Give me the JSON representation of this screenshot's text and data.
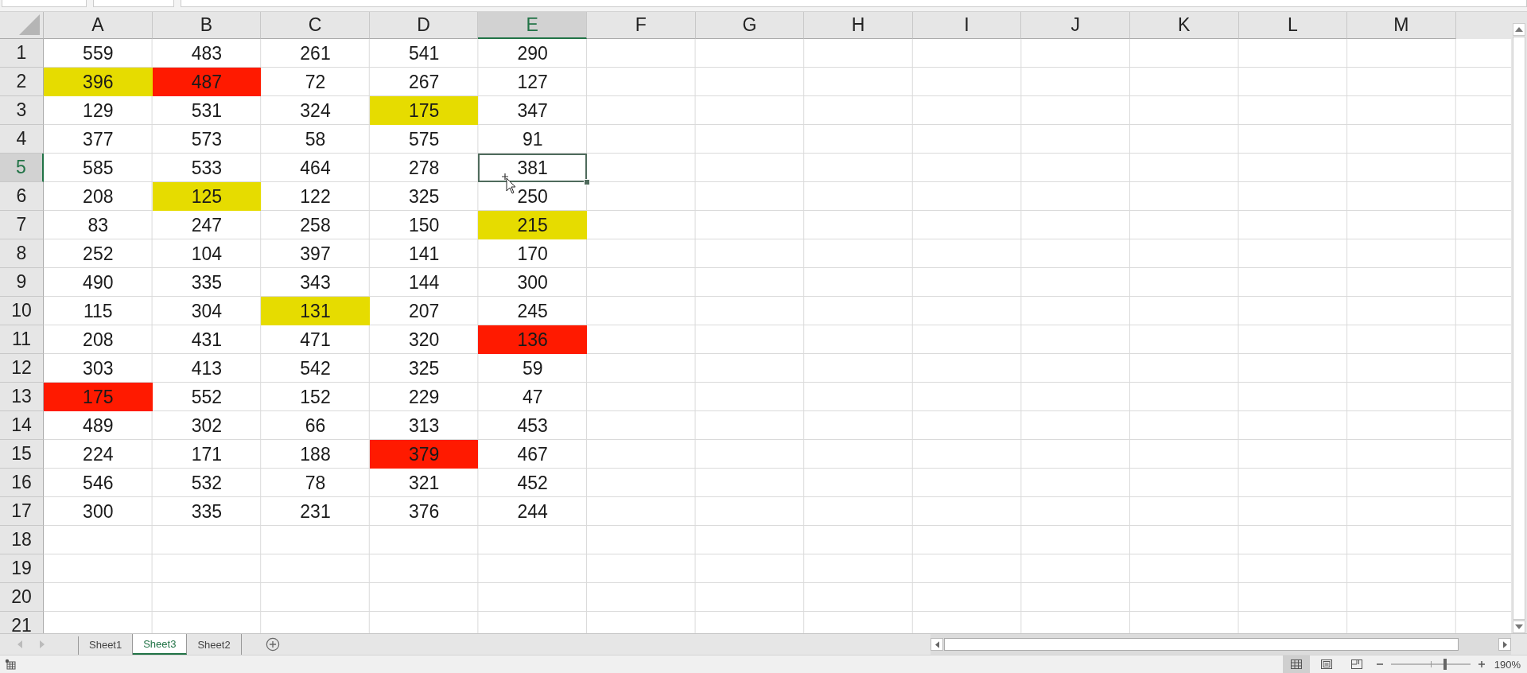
{
  "columns": [
    {
      "label": "A"
    },
    {
      "label": "B"
    },
    {
      "label": "C"
    },
    {
      "label": "D"
    },
    {
      "label": "E"
    },
    {
      "label": "F"
    },
    {
      "label": "G"
    },
    {
      "label": "H"
    },
    {
      "label": "I"
    },
    {
      "label": "J"
    },
    {
      "label": "K"
    },
    {
      "label": "L"
    },
    {
      "label": "M"
    }
  ],
  "rows": [
    {
      "number": "1",
      "cells": [
        {
          "value": "559",
          "selected": false
        },
        {
          "value": "483",
          "selected": false
        },
        {
          "value": "261",
          "selected": false
        },
        {
          "value": "541",
          "selected": false
        },
        {
          "value": "290",
          "selected": false
        }
      ]
    },
    {
      "number": "2",
      "cells": [
        {
          "value": "396",
          "selected": false,
          "color": "#e6dc00"
        },
        {
          "value": "487",
          "selected": false,
          "color": "#ff1a00"
        },
        {
          "value": "72",
          "selected": false
        },
        {
          "value": "267",
          "selected": false
        },
        {
          "value": "127",
          "selected": false
        }
      ]
    },
    {
      "number": "3",
      "cells": [
        {
          "value": "129",
          "selected": false
        },
        {
          "value": "531",
          "selected": false
        },
        {
          "value": "324",
          "selected": false
        },
        {
          "value": "175",
          "selected": false,
          "color": "#e6dc00"
        },
        {
          "value": "347",
          "selected": false
        }
      ]
    },
    {
      "number": "4",
      "cells": [
        {
          "value": "377",
          "selected": false
        },
        {
          "value": "573",
          "selected": false
        },
        {
          "value": "58",
          "selected": false
        },
        {
          "value": "575",
          "selected": false
        },
        {
          "value": "91",
          "selected": false
        }
      ]
    },
    {
      "number": "5",
      "cells": [
        {
          "value": "585",
          "selected": false
        },
        {
          "value": "533",
          "selected": false
        },
        {
          "value": "464",
          "selected": false
        },
        {
          "value": "278",
          "selected": false
        },
        {
          "value": "381",
          "selected": true
        }
      ]
    },
    {
      "number": "6",
      "cells": [
        {
          "value": "208",
          "selected": false
        },
        {
          "value": "125",
          "selected": false,
          "color": "#e6dc00"
        },
        {
          "value": "122",
          "selected": false
        },
        {
          "value": "325",
          "selected": false
        },
        {
          "value": "250",
          "selected": false
        }
      ]
    },
    {
      "number": "7",
      "cells": [
        {
          "value": "83",
          "selected": false
        },
        {
          "value": "247",
          "selected": false
        },
        {
          "value": "258",
          "selected": false
        },
        {
          "value": "150",
          "selected": false
        },
        {
          "value": "215",
          "selected": false,
          "color": "#e6dc00"
        }
      ]
    },
    {
      "number": "8",
      "cells": [
        {
          "value": "252",
          "selected": false
        },
        {
          "value": "104",
          "selected": false
        },
        {
          "value": "397",
          "selected": false
        },
        {
          "value": "141",
          "selected": false
        },
        {
          "value": "170",
          "selected": false
        }
      ]
    },
    {
      "number": "9",
      "cells": [
        {
          "value": "490",
          "selected": false
        },
        {
          "value": "335",
          "selected": false
        },
        {
          "value": "343",
          "selected": false
        },
        {
          "value": "144",
          "selected": false
        },
        {
          "value": "300",
          "selected": false
        }
      ]
    },
    {
      "number": "10",
      "cells": [
        {
          "value": "115",
          "selected": false
        },
        {
          "value": "304",
          "selected": false
        },
        {
          "value": "131",
          "selected": false,
          "color": "#e6dc00"
        },
        {
          "value": "207",
          "selected": false
        },
        {
          "value": "245",
          "selected": false
        }
      ]
    },
    {
      "number": "11",
      "cells": [
        {
          "value": "208",
          "selected": false
        },
        {
          "value": "431",
          "selected": false
        },
        {
          "value": "471",
          "selected": false
        },
        {
          "value": "320",
          "selected": false
        },
        {
          "value": "136",
          "selected": false,
          "color": "#ff1a00"
        }
      ]
    },
    {
      "number": "12",
      "cells": [
        {
          "value": "303",
          "selected": false
        },
        {
          "value": "413",
          "selected": false
        },
        {
          "value": "542",
          "selected": false
        },
        {
          "value": "325",
          "selected": false
        },
        {
          "value": "59",
          "selected": false
        }
      ]
    },
    {
      "number": "13",
      "cells": [
        {
          "value": "175",
          "selected": false,
          "color": "#ff1a00"
        },
        {
          "value": "552",
          "selected": false
        },
        {
          "value": "152",
          "selected": false
        },
        {
          "value": "229",
          "selected": false
        },
        {
          "value": "47",
          "selected": false
        }
      ]
    },
    {
      "number": "14",
      "cells": [
        {
          "value": "489",
          "selected": false
        },
        {
          "value": "302",
          "selected": false
        },
        {
          "value": "66",
          "selected": false
        },
        {
          "value": "313",
          "selected": false
        },
        {
          "value": "453",
          "selected": false
        }
      ]
    },
    {
      "number": "15",
      "cells": [
        {
          "value": "224",
          "selected": false
        },
        {
          "value": "171",
          "selected": false
        },
        {
          "value": "188",
          "selected": false
        },
        {
          "value": "379",
          "selected": false,
          "color": "#ff1a00"
        },
        {
          "value": "467",
          "selected": false
        }
      ]
    },
    {
      "number": "16",
      "cells": [
        {
          "value": "546",
          "selected": false
        },
        {
          "value": "532",
          "selected": false
        },
        {
          "value": "78",
          "selected": false
        },
        {
          "value": "321",
          "selected": false
        },
        {
          "value": "452",
          "selected": false
        }
      ]
    },
    {
      "number": "17",
      "cells": [
        {
          "value": "300",
          "selected": false
        },
        {
          "value": "335",
          "selected": false
        },
        {
          "value": "231",
          "selected": false
        },
        {
          "value": "376",
          "selected": false
        },
        {
          "value": "244",
          "selected": false
        }
      ]
    },
    {
      "number": "18"
    },
    {
      "number": "19"
    },
    {
      "number": "20"
    },
    {
      "number": "21"
    }
  ],
  "sheet_tabs": [
    {
      "label": "Sheet1",
      "selected": false
    },
    {
      "label": "Sheet3",
      "selected": true
    },
    {
      "label": "Sheet2",
      "selected": false
    }
  ],
  "status_bar": {
    "views": [
      {
        "kind": "normal",
        "selected": true
      },
      {
        "kind": "layout",
        "selected": false
      },
      {
        "kind": "pagebreak",
        "selected": false
      }
    ],
    "zoom": {
      "level": 0.66,
      "reading": "190%"
    }
  }
}
